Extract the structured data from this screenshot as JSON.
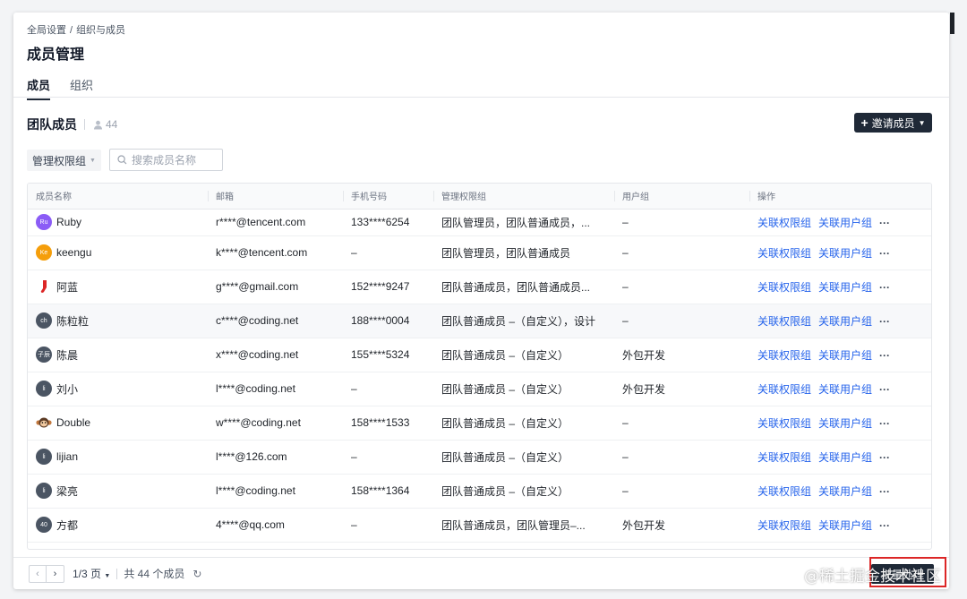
{
  "breadcrumb": [
    "全局设置",
    "/",
    "组织与成员"
  ],
  "page_title": "成员管理",
  "tabs": [
    {
      "label": "成员",
      "active": true
    },
    {
      "label": "组织",
      "active": false
    }
  ],
  "section": {
    "title": "团队成员",
    "member_count": "44"
  },
  "invite_button": {
    "label": "邀请成员",
    "icon": "plus-icon"
  },
  "filter": {
    "label": "管理权限组"
  },
  "search": {
    "placeholder": "搜索成员名称"
  },
  "table": {
    "columns": [
      "成员名称",
      "邮箱",
      "手机号码",
      "管理权限组",
      "用户组",
      "操作"
    ],
    "action_link_1": "关联权限组",
    "action_link_2": "关联用户组",
    "rows": [
      {
        "avatar": "Ru",
        "avatar_color": "#8b5cf6",
        "name": "Ruby",
        "email": "r****@tencent.com",
        "phone": "133****6254",
        "roles": "团队管理员，团队普通成员，...",
        "group": "–"
      },
      {
        "avatar": "Ke",
        "avatar_color": "#f59e0b",
        "name": "keengu",
        "email": "k****@tencent.com",
        "phone": "–",
        "roles": "团队管理员，团队普通成员",
        "group": "–"
      },
      {
        "avatar": "",
        "avatar_color": "#ffffff",
        "name": "阿蓝",
        "email": "g****@gmail.com",
        "phone": "152****9247",
        "roles": "团队普通成员，团队普通成员...",
        "group": "–"
      },
      {
        "avatar": "ch",
        "avatar_color": "#4b5563",
        "name": "陈粒粒",
        "email": "c****@coding.net",
        "phone": "188****0004",
        "roles": "团队普通成员 –（自定义），设计",
        "group": "–"
      },
      {
        "avatar": "子辰",
        "avatar_color": "#4b5563",
        "name": "陈晨",
        "email": "x****@coding.net",
        "phone": "155****5324",
        "roles": "团队普通成员 –（自定义）",
        "group": "外包开发"
      },
      {
        "avatar": "li",
        "avatar_color": "#4b5563",
        "name": "刘小",
        "email": "l****@coding.net",
        "phone": "–",
        "roles": "团队普通成员 –（自定义）",
        "group": "外包开发"
      },
      {
        "avatar": "",
        "avatar_color": "#ffffff",
        "name": "Double",
        "email": "w****@coding.net",
        "phone": "158****1533",
        "roles": "团队普通成员 –（自定义）",
        "group": "–"
      },
      {
        "avatar": "li",
        "avatar_color": "#4b5563",
        "name": "lijian",
        "email": "l****@126.com",
        "phone": "–",
        "roles": "团队普通成员 –（自定义）",
        "group": "–"
      },
      {
        "avatar": "li",
        "avatar_color": "#4b5563",
        "name": "梁亮",
        "email": "l****@coding.net",
        "phone": "158****1364",
        "roles": "团队普通成员 –（自定义）",
        "group": "–"
      },
      {
        "avatar": "40",
        "avatar_color": "#4b5563",
        "name": "方都",
        "email": "4****@qq.com",
        "phone": "–",
        "roles": "团队普通成员，团队管理员–...",
        "group": "外包开发"
      }
    ]
  },
  "footer": {
    "page_indicator": "1/3 页",
    "total": "共 44 个成员",
    "batch_button": "批量处理"
  },
  "watermark": "@稀土掘金技术社区",
  "colors": {
    "primary": "#1f2937",
    "link": "#2563eb",
    "highlight": "#dc2626"
  }
}
